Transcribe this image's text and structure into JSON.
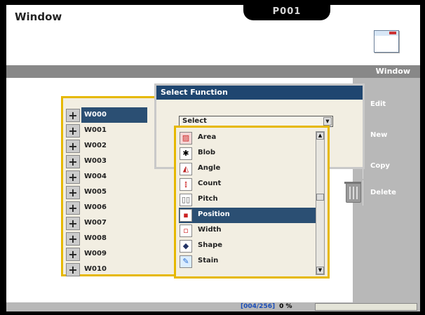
{
  "window": {
    "title": "Window",
    "program_tab": "P001"
  },
  "menu_bar": {
    "label": "Window"
  },
  "sidebar": {
    "buttons": [
      {
        "label": "Edit"
      },
      {
        "label": "New"
      },
      {
        "label": "Copy"
      },
      {
        "label": "Delete",
        "icon": "trash-icon"
      }
    ]
  },
  "window_list": {
    "items": [
      "W000",
      "W001",
      "W002",
      "W003",
      "W004",
      "W005",
      "W006",
      "W007",
      "W008",
      "W009",
      "W010"
    ],
    "selected": "W000"
  },
  "dialog": {
    "title": "Select Function",
    "select_value": "Select"
  },
  "function_options": [
    {
      "label": "Area",
      "icon": "area-icon"
    },
    {
      "label": "Blob",
      "icon": "blob-icon"
    },
    {
      "label": "Angle",
      "icon": "angle-icon"
    },
    {
      "label": "Count",
      "icon": "count-icon"
    },
    {
      "label": "Pitch",
      "icon": "pitch-icon"
    },
    {
      "label": "Position",
      "icon": "position-icon",
      "selected": true
    },
    {
      "label": "Width",
      "icon": "width-icon"
    },
    {
      "label": "Shape",
      "icon": "shape-icon"
    },
    {
      "label": "Stain",
      "icon": "stain-icon"
    }
  ],
  "status": {
    "counter": "[004/256]",
    "percent": "0 %"
  },
  "colors": {
    "selection": "#2b4f73",
    "highlight_border": "#e6b800",
    "title_bar": "#1f4670"
  }
}
